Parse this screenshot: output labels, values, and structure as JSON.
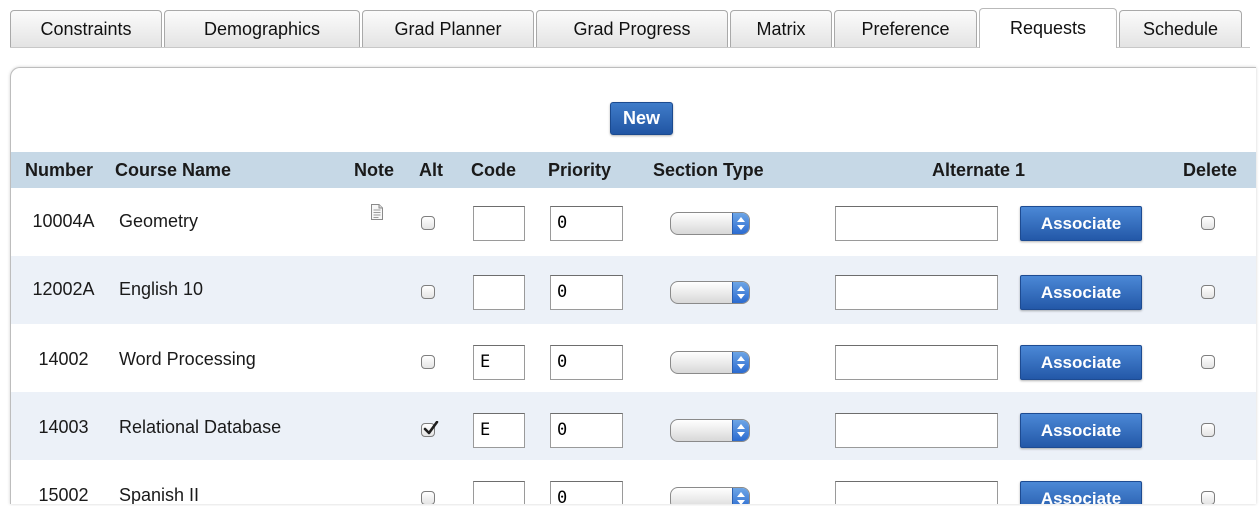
{
  "tabs": [
    {
      "label": "Constraints",
      "active": false
    },
    {
      "label": "Demographics",
      "active": false
    },
    {
      "label": "Grad Planner",
      "active": false
    },
    {
      "label": "Grad Progress",
      "active": false
    },
    {
      "label": "Matrix",
      "active": false
    },
    {
      "label": "Preference",
      "active": false
    },
    {
      "label": "Requests",
      "active": true
    },
    {
      "label": "Schedule",
      "active": false
    }
  ],
  "toolbar": {
    "new_label": "New"
  },
  "columns": {
    "number": "Number",
    "course_name": "Course Name",
    "note": "Note",
    "alt": "Alt",
    "code": "Code",
    "priority": "Priority",
    "section_type": "Section Type",
    "alternate1": "Alternate 1",
    "delete": "Delete"
  },
  "rows": [
    {
      "number": "10004A",
      "course_name": "Geometry",
      "has_note": true,
      "alt": false,
      "code": "",
      "priority": "0",
      "section_type": "",
      "alternate1": "",
      "associate_label": "Associate",
      "delete": false
    },
    {
      "number": "12002A",
      "course_name": "English 10",
      "has_note": false,
      "alt": false,
      "code": "",
      "priority": "0",
      "section_type": "",
      "alternate1": "",
      "associate_label": "Associate",
      "delete": false
    },
    {
      "number": "14002",
      "course_name": "Word Processing",
      "has_note": false,
      "alt": false,
      "code": "E",
      "priority": "0",
      "section_type": "",
      "alternate1": "",
      "associate_label": "Associate",
      "delete": false
    },
    {
      "number": "14003",
      "course_name": "Relational Database",
      "has_note": false,
      "alt": true,
      "code": "E",
      "priority": "0",
      "section_type": "",
      "alternate1": "",
      "associate_label": "Associate",
      "delete": false
    },
    {
      "number": "15002",
      "course_name": "Spanish II",
      "has_note": false,
      "alt": false,
      "code": "",
      "priority": "0",
      "section_type": "",
      "alternate1": "",
      "associate_label": "Associate",
      "delete": false
    }
  ],
  "colors": {
    "header_bg": "#c6d8e6",
    "row_alt_bg": "#ecf1f8",
    "button_blue": "#2a62b4"
  }
}
